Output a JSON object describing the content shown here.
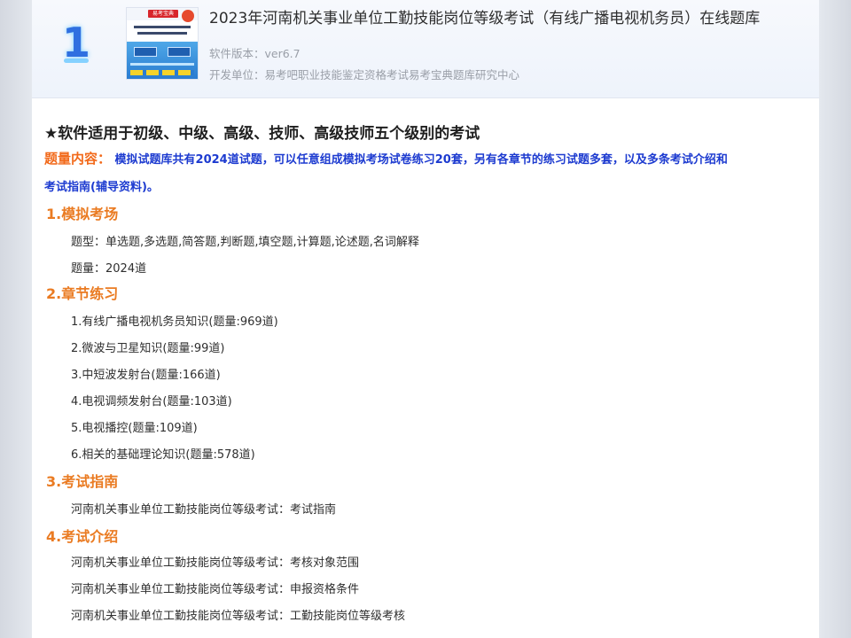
{
  "header": {
    "rank": "1",
    "cover_badge": "易考宝典",
    "title": "2023年河南机关事业单位工勤技能岗位等级考试（有线广播电视机务员）在线题库",
    "version": "软件版本：ver6.7",
    "developer": "开发单位：易考吧职业技能鉴定资格考试易考宝典题库研究中心"
  },
  "content": {
    "star_line": "★软件适用于初级、中级、高级、技师、高级技师五个级别的考试",
    "question_content_label": "题量内容：",
    "question_content_text": "模拟试题库共有2024道试题，可以任意组成模拟考场试卷练习20套，另有各章节的练习试题多套，以及多条考试介绍和",
    "question_content_text2": "考试指南(辅导资料)。",
    "sections": [
      {
        "title": "1.模拟考场",
        "items": [
          "题型：单选题,多选题,简答题,判断题,填空题,计算题,论述题,名词解释",
          "题量：2024道"
        ]
      },
      {
        "title": "2.章节练习",
        "items": [
          "1.有线广播电视机务员知识(题量:969道)",
          "2.微波与卫星知识(题量:99道)",
          "3.中短波发射台(题量:166道)",
          "4.电视调频发射台(题量:103道)",
          "5.电视播控(题量:109道)",
          "6.相关的基础理论知识(题量:578道)"
        ]
      },
      {
        "title": "3.考试指南",
        "items": [
          "河南机关事业单位工勤技能岗位等级考试：考试指南"
        ]
      },
      {
        "title": "4.考试介绍",
        "items": [
          "河南机关事业单位工勤技能岗位等级考试：考核对象范围",
          "河南机关事业单位工勤技能岗位等级考试：申报资格条件",
          "河南机关事业单位工勤技能岗位等级考试：工勤技能岗位等级考核"
        ]
      }
    ]
  }
}
